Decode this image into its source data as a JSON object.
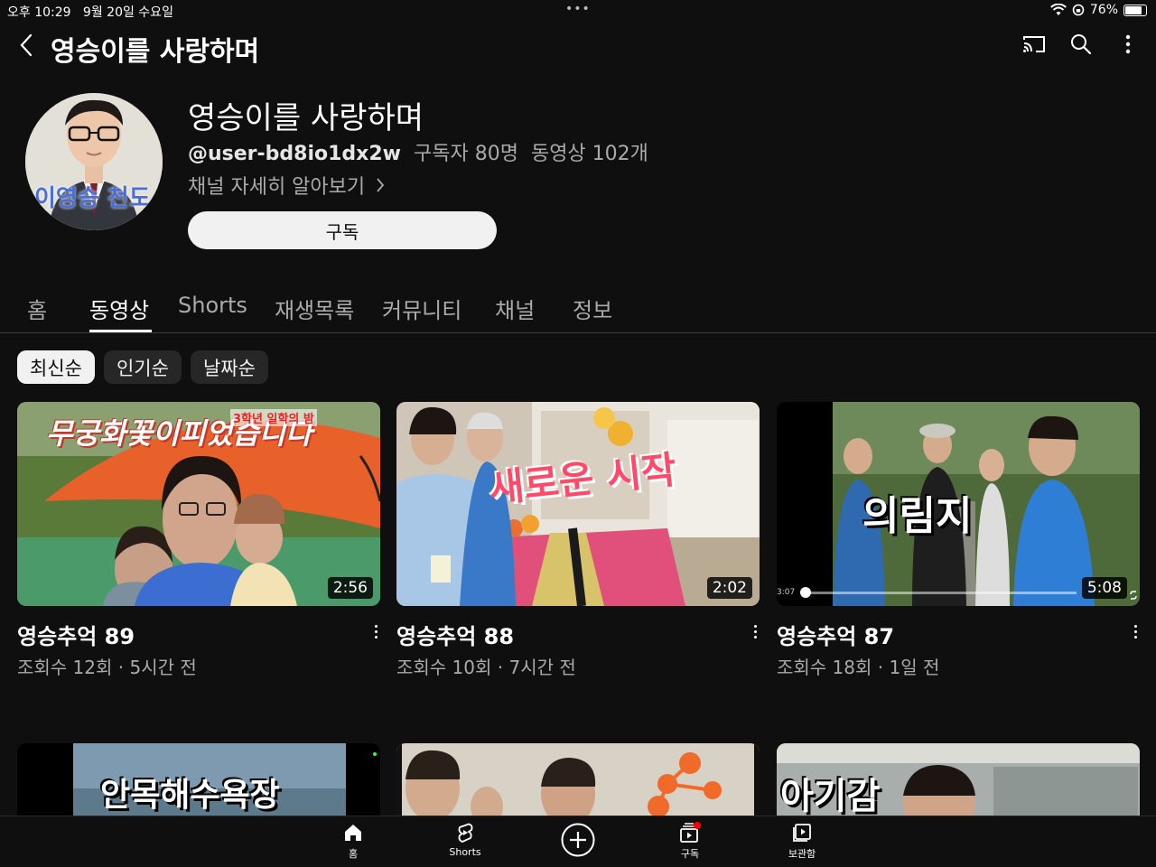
{
  "status": {
    "time": "오후 10:29",
    "date": "9월 20일 수요일",
    "dots": "•••",
    "battery": "76%"
  },
  "header": {
    "title": "영승이를 사랑하며"
  },
  "channel": {
    "avatar_text": "이영승 천도",
    "name": "영승이를 사랑하며",
    "handle": "@user-bd8io1dx2w",
    "subscribers": "구독자 80명",
    "videos": "동영상 102개",
    "more_link": "채널 자세히 알아보기",
    "subscribe_label": "구독"
  },
  "tabs": [
    "홈",
    "동영상",
    "Shorts",
    "재생목록",
    "커뮤니티",
    "채널",
    "정보"
  ],
  "active_tab": "동영상",
  "chips": [
    "최신순",
    "인기순",
    "날짜순"
  ],
  "active_chip": "최신순",
  "videos": [
    {
      "thumb_text": "무궁화꽃이피었습니다",
      "thumb_badge": "3학년 일학의 밤",
      "duration": "2:56",
      "title": "영승추억 89",
      "meta": "조회수 12회 · 5시간 전"
    },
    {
      "thumb_text": "새로운 시작",
      "duration": "2:02",
      "title": "영승추억 88",
      "meta": "조회수 10회 · 7시간 전"
    },
    {
      "thumb_text": "의림지",
      "duration": "5:08",
      "time_code": "3:07",
      "title": "영승추억 87",
      "meta": "조회수 18회 · 1일 전"
    }
  ],
  "videos_row2": [
    {
      "thumb_text": "안목해수욕장"
    },
    {
      "thumb_text": ""
    },
    {
      "thumb_text": "아기감"
    }
  ],
  "nav": [
    {
      "label": "홈",
      "icon": "home-icon"
    },
    {
      "label": "Shorts",
      "icon": "shorts-icon"
    },
    {
      "label": "",
      "icon": "create-icon"
    },
    {
      "label": "구독",
      "icon": "subscriptions-icon"
    },
    {
      "label": "보관함",
      "icon": "library-icon"
    }
  ],
  "colors": {
    "background": "#0f0f0f",
    "text": "#f1f1f1",
    "secondary_text": "#aaaaaa",
    "notification_dot": "#ff0000"
  }
}
